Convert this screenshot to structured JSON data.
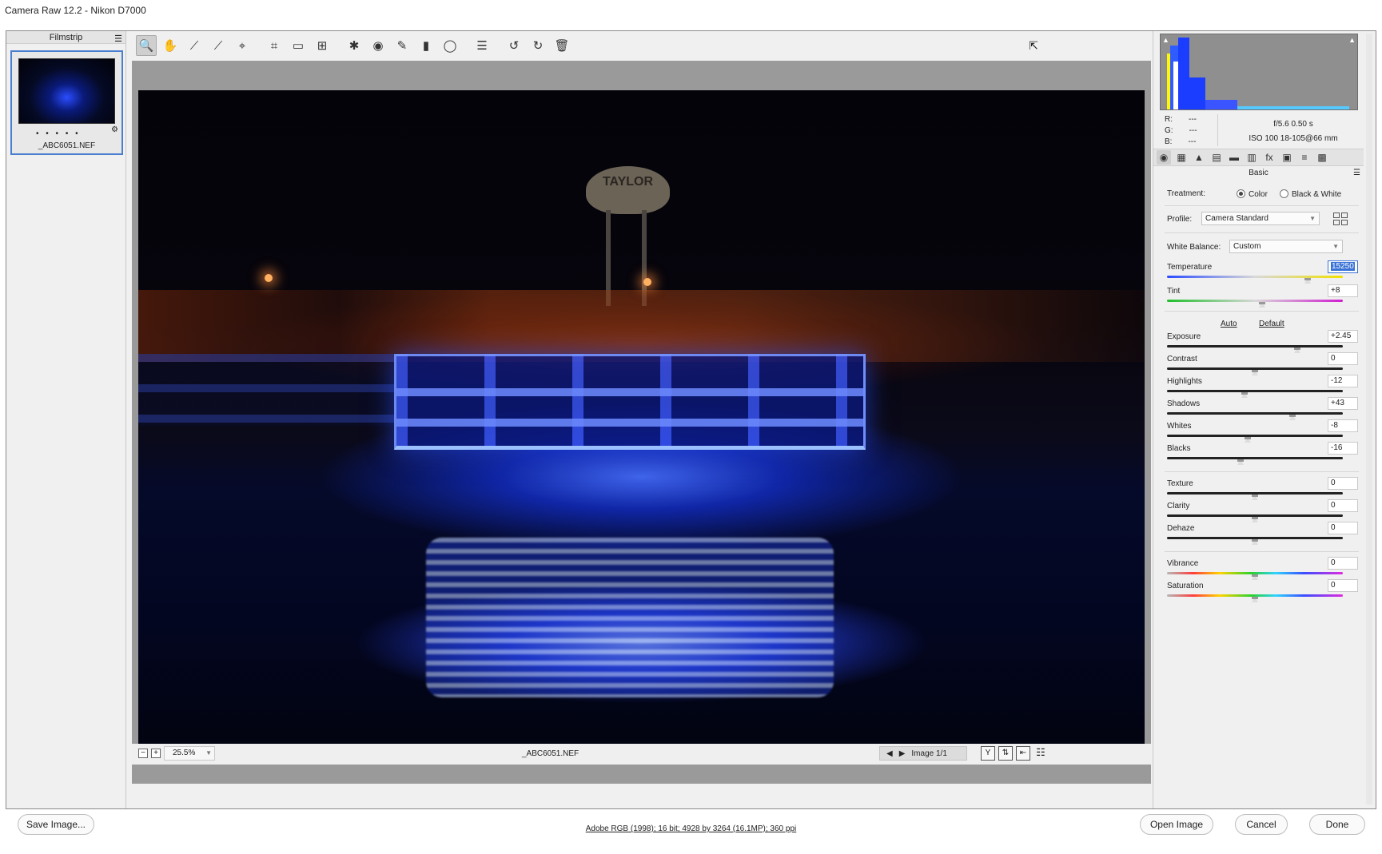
{
  "window": {
    "title": "Camera Raw 12.2  -  Nikon D7000"
  },
  "filmstrip": {
    "header": "Filmstrip",
    "items": [
      {
        "name": "_ABC6051.NEF",
        "rating_dots": "• • • • •"
      }
    ]
  },
  "toolbar": {
    "tools": [
      {
        "id": "zoom",
        "icon": "magnifier-icon",
        "glyph": "🔍",
        "active": true
      },
      {
        "id": "hand",
        "icon": "hand-icon",
        "glyph": "✋"
      },
      {
        "id": "wb",
        "icon": "eyedropper-icon",
        "glyph": "⟋"
      },
      {
        "id": "color-sampler",
        "icon": "color-sampler-icon",
        "glyph": "⟋"
      },
      {
        "id": "target-adjust",
        "icon": "target-adjust-icon",
        "glyph": "⌖"
      },
      {
        "id": "crop",
        "icon": "crop-icon",
        "glyph": "⌗"
      },
      {
        "id": "straighten",
        "icon": "straighten-icon",
        "glyph": "▭"
      },
      {
        "id": "transform",
        "icon": "transform-icon",
        "glyph": "⊞"
      },
      {
        "id": "spot-removal",
        "icon": "spot-removal-icon",
        "glyph": "✱"
      },
      {
        "id": "red-eye",
        "icon": "red-eye-icon",
        "glyph": "◉"
      },
      {
        "id": "brush",
        "icon": "adjustment-brush-icon",
        "glyph": "✎"
      },
      {
        "id": "graduated",
        "icon": "graduated-filter-icon",
        "glyph": "▮"
      },
      {
        "id": "radial",
        "icon": "radial-filter-icon",
        "glyph": "◯"
      },
      {
        "id": "presets",
        "icon": "preferences-list-icon",
        "glyph": "☰"
      },
      {
        "id": "rotate-left",
        "icon": "rotate-left-icon",
        "glyph": "↺"
      },
      {
        "id": "rotate-right",
        "icon": "rotate-right-icon",
        "glyph": "↻"
      },
      {
        "id": "trash",
        "icon": "trash-icon",
        "glyph": "🗑"
      }
    ],
    "fullscreen_glyph": "⇱"
  },
  "preview": {
    "tower_text": "TAYLOR",
    "zoom_level": "25.5%",
    "zoom_out": "−",
    "zoom_in": "+",
    "filename": "_ABC6051.NEF",
    "image_counter": "Image 1/1",
    "nav_prev": "◀",
    "nav_next": "▶",
    "view_buttons": [
      {
        "name": "before-after-icon",
        "glyph": "Y"
      },
      {
        "name": "swap-icon",
        "glyph": "⇅"
      },
      {
        "name": "copy-settings-icon",
        "glyph": "⇤"
      },
      {
        "name": "view-settings-icon",
        "glyph": "☷"
      }
    ]
  },
  "histogram": {
    "clip_shadow": "▲",
    "clip_highlight": "▲",
    "rgb": {
      "r_label": "R:",
      "r_value": "---",
      "g_label": "G:",
      "g_value": "---",
      "b_label": "B:",
      "b_value": "---"
    },
    "meta_line1": "f/5.6   0.50 s",
    "meta_line2": "ISO 100   18-105@66 mm"
  },
  "panel_tabs": [
    {
      "name": "basic-tab-icon",
      "glyph": "◉",
      "active": true
    },
    {
      "name": "tone-curve-tab-icon",
      "glyph": "▦"
    },
    {
      "name": "detail-tab-icon",
      "glyph": "▲"
    },
    {
      "name": "hsl-tab-icon",
      "glyph": "▤"
    },
    {
      "name": "split-toning-tab-icon",
      "glyph": "▬"
    },
    {
      "name": "lens-tab-icon",
      "glyph": "▥"
    },
    {
      "name": "effects-tab-icon",
      "glyph": "fx"
    },
    {
      "name": "calibration-tab-icon",
      "glyph": "▣"
    },
    {
      "name": "presets-tab-icon",
      "glyph": "≡"
    },
    {
      "name": "snapshots-tab-icon",
      "glyph": "▩"
    }
  ],
  "basic": {
    "title": "Basic",
    "treatment_label": "Treatment:",
    "treatment_color": "Color",
    "treatment_bw": "Black & White",
    "profile_label": "Profile:",
    "profile_value": "Camera Standard",
    "wb_label": "White Balance:",
    "wb_value": "Custom",
    "auto": "Auto",
    "default": "Default",
    "sliders": [
      {
        "label": "Temperature",
        "value": "15250",
        "position": 0.8,
        "track": "temp",
        "selected": true
      },
      {
        "label": "Tint",
        "value": "+8",
        "position": 0.54,
        "track": "tint"
      },
      {
        "label": "Exposure",
        "value": "+2.45",
        "position": 0.74,
        "track": "gray"
      },
      {
        "label": "Contrast",
        "value": "0",
        "position": 0.5,
        "track": "gray"
      },
      {
        "label": "Highlights",
        "value": "-12",
        "position": 0.44,
        "track": "gray"
      },
      {
        "label": "Shadows",
        "value": "+43",
        "position": 0.715,
        "track": "gray"
      },
      {
        "label": "Whites",
        "value": "-8",
        "position": 0.46,
        "track": "gray"
      },
      {
        "label": "Blacks",
        "value": "-16",
        "position": 0.42,
        "track": "gray"
      },
      {
        "label": "Texture",
        "value": "0",
        "position": 0.5,
        "track": "gray"
      },
      {
        "label": "Clarity",
        "value": "0",
        "position": 0.5,
        "track": "gray"
      },
      {
        "label": "Dehaze",
        "value": "0",
        "position": 0.5,
        "track": "gray"
      },
      {
        "label": "Vibrance",
        "value": "0",
        "position": 0.5,
        "track": "rainbow"
      },
      {
        "label": "Saturation",
        "value": "0",
        "position": 0.5,
        "track": "rainbow"
      }
    ]
  },
  "footer": {
    "save": "Save Image...",
    "info": "Adobe RGB (1998); 16 bit; 4928 by 3264 (16.1MP); 360 ppi",
    "open": "Open Image",
    "cancel": "Cancel",
    "done": "Done"
  }
}
